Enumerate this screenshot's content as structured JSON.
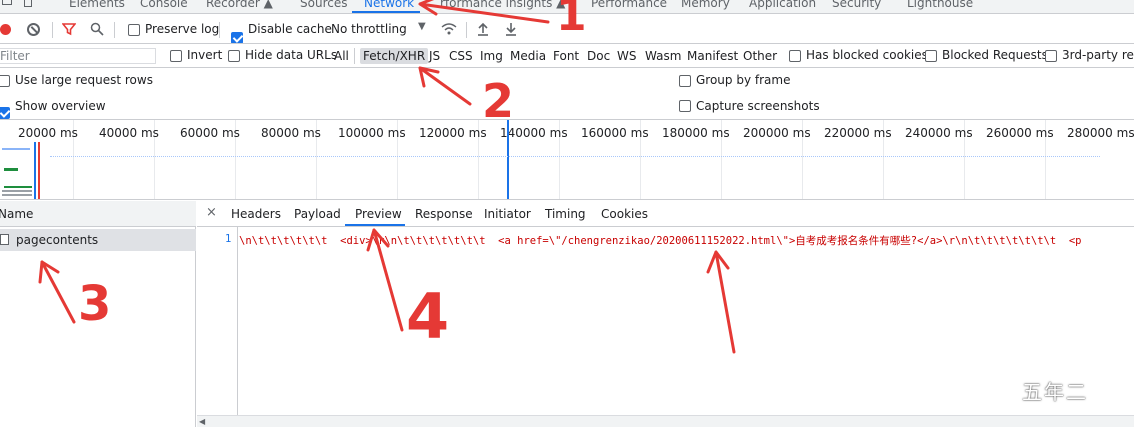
{
  "top_tabs": [
    "Elements",
    "Console",
    "Recorder ▲",
    "Sources",
    "Network",
    "rformance insights ▲",
    "Performance",
    "Memory",
    "Application",
    "Security",
    "Lighthouse"
  ],
  "toolbar": {
    "preserve_log": "Preserve log",
    "disable_cache": "Disable cache",
    "throttling": "No throttling"
  },
  "filter": {
    "placeholder": "Filter",
    "invert": "Invert",
    "hide_data_urls": "Hide data URLs",
    "types": [
      "All",
      "Fetch/XHR",
      "JS",
      "CSS",
      "Img",
      "Media",
      "Font",
      "Doc",
      "WS",
      "Wasm",
      "Manifest",
      "Other"
    ],
    "has_blocked_cookies": "Has blocked cookies",
    "blocked_requests": "Blocked Requests",
    "third_party": "3rd-party requ"
  },
  "options": {
    "large_rows": "Use large request rows",
    "group_by_frame": "Group by frame",
    "show_overview": "Show overview",
    "capture_screenshots": "Capture screenshots"
  },
  "timeline_ticks": [
    "20000 ms",
    "40000 ms",
    "60000 ms",
    "80000 ms",
    "100000 ms",
    "120000 ms",
    "140000 ms",
    "160000 ms",
    "180000 ms",
    "200000 ms",
    "220000 ms",
    "240000 ms",
    "260000 ms",
    "280000 ms"
  ],
  "names": {
    "header": "Name",
    "item": "pagecontents"
  },
  "detail_tabs": [
    "Headers",
    "Payload",
    "Preview",
    "Response",
    "Initiator",
    "Timing",
    "Cookies"
  ],
  "preview": {
    "line_number": "1",
    "code": "\\n\\t\\t\\t\\t\\t\\t  <div>\\r\\n\\t\\t\\t\\t\\t\\t\\t  <a href=\\\"/chengrenzikao/20200611152022.html\\\">自考成考报名条件有哪些?</a>\\r\\n\\t\\t\\t\\t\\t\\t\\t  <p"
  },
  "annotations": [
    "1",
    "2",
    "3",
    "4"
  ],
  "watermark": "五年二"
}
